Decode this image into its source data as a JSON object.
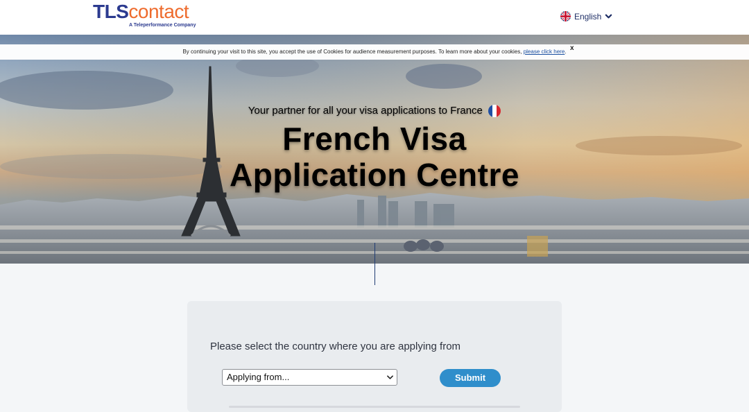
{
  "header": {
    "logo_tls": "TLS",
    "logo_contact": "contact",
    "logo_tagline": "A Teleperformance Company",
    "language": "English",
    "language_flag_icon": "uk-flag-icon"
  },
  "cookie_bar": {
    "text": "By continuing your visit to this site, you accept the use of Cookies for audience measurement purposes. To learn more about your cookies, ",
    "link": "please click here",
    "suffix": ".",
    "close": "x"
  },
  "hero": {
    "tagline": "Your partner for all your visa applications to France",
    "title_line1": "French Visa",
    "title_line2": "Application Centre",
    "flag_icon": "france-flag-icon"
  },
  "form": {
    "prompt": "Please select the country where you are applying from",
    "select_value": "Applying from...",
    "submit_label": "Submit"
  },
  "colors": {
    "brand_blue": "#2b3a8f",
    "brand_orange": "#ee6b2d",
    "button_blue": "#2f8ecb"
  }
}
